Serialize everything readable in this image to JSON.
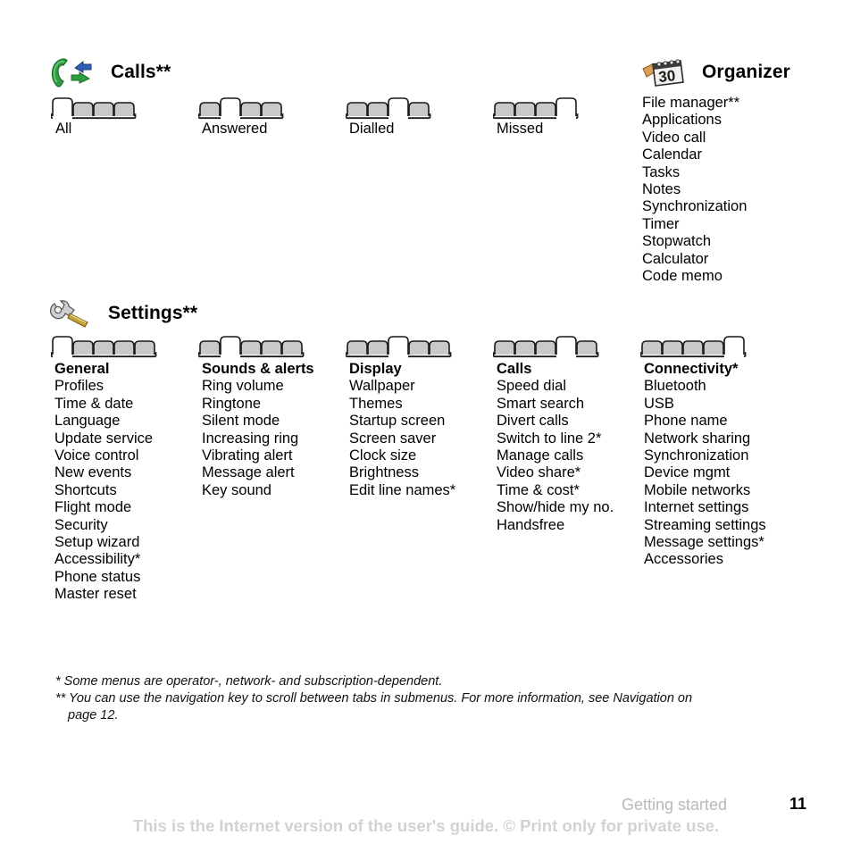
{
  "page": {
    "chapter": "Getting started",
    "number": "11",
    "notice": "This is the Internet version of the user's guide. © Print only for private use."
  },
  "sections": [
    {
      "id": "calls",
      "title": "Calls**",
      "icon": "calls-icon",
      "tabs": [
        {
          "label": "All",
          "count": 4,
          "selected": 1
        },
        {
          "label": "Answered",
          "count": 4,
          "selected": 2
        },
        {
          "label": "Dialled",
          "count": 4,
          "selected": 3
        },
        {
          "label": "Missed",
          "count": 4,
          "selected": 4
        }
      ]
    },
    {
      "id": "organizer",
      "title": "Organizer",
      "icon": "organizer-icon",
      "items": [
        "File manager**",
        "Applications",
        "Video call",
        "Calendar",
        "Tasks",
        "Notes",
        "Synchronization",
        "Timer",
        "Stopwatch",
        "Calculator",
        "Code memo"
      ]
    },
    {
      "id": "settings",
      "title": "Settings**",
      "icon": "settings-icon",
      "columns": [
        {
          "head": "General",
          "count": 5,
          "selected": 1,
          "items": [
            "Profiles",
            "Time & date",
            "Language",
            "Update service",
            "Voice control",
            "New events",
            "Shortcuts",
            "Flight mode",
            "Security",
            "Setup wizard",
            "Accessibility*",
            "Phone status",
            "Master reset"
          ]
        },
        {
          "head": "Sounds & alerts",
          "count": 5,
          "selected": 2,
          "items": [
            "Ring volume",
            "Ringtone",
            "Silent mode",
            "Increasing ring",
            "Vibrating alert",
            "Message alert",
            "Key sound"
          ]
        },
        {
          "head": "Display",
          "count": 5,
          "selected": 3,
          "items": [
            "Wallpaper",
            "Themes",
            "Startup screen",
            "Screen saver",
            "Clock size",
            "Brightness",
            "Edit line names*"
          ]
        },
        {
          "head": "Calls",
          "count": 5,
          "selected": 4,
          "items": [
            "Speed dial",
            "Smart search",
            "Divert calls",
            "Switch to line 2*",
            "Manage calls",
            "Video share*",
            "Time & cost*",
            "Show/hide my no.",
            "Handsfree"
          ]
        },
        {
          "head": "Connectivity*",
          "count": 5,
          "selected": 5,
          "items": [
            "Bluetooth",
            "USB",
            "Phone name",
            "Network sharing",
            "Synchronization",
            "Device mgmt",
            "Mobile networks",
            "Internet settings",
            "Streaming settings",
            "Message settings*",
            "Accessories"
          ]
        }
      ]
    }
  ],
  "footnotes": [
    "* Some menus are operator-, network- and subscription-dependent.",
    "** You can use the navigation key to scroll between tabs in submenus. For more information, see Navigation on",
    "page 12."
  ],
  "colors": {
    "tab_fill": "#c9c9c9",
    "tab_outline": "#1a1a1a",
    "notice_gray": "#d2d2d2",
    "chapter_gray": "#b9b9b9"
  }
}
